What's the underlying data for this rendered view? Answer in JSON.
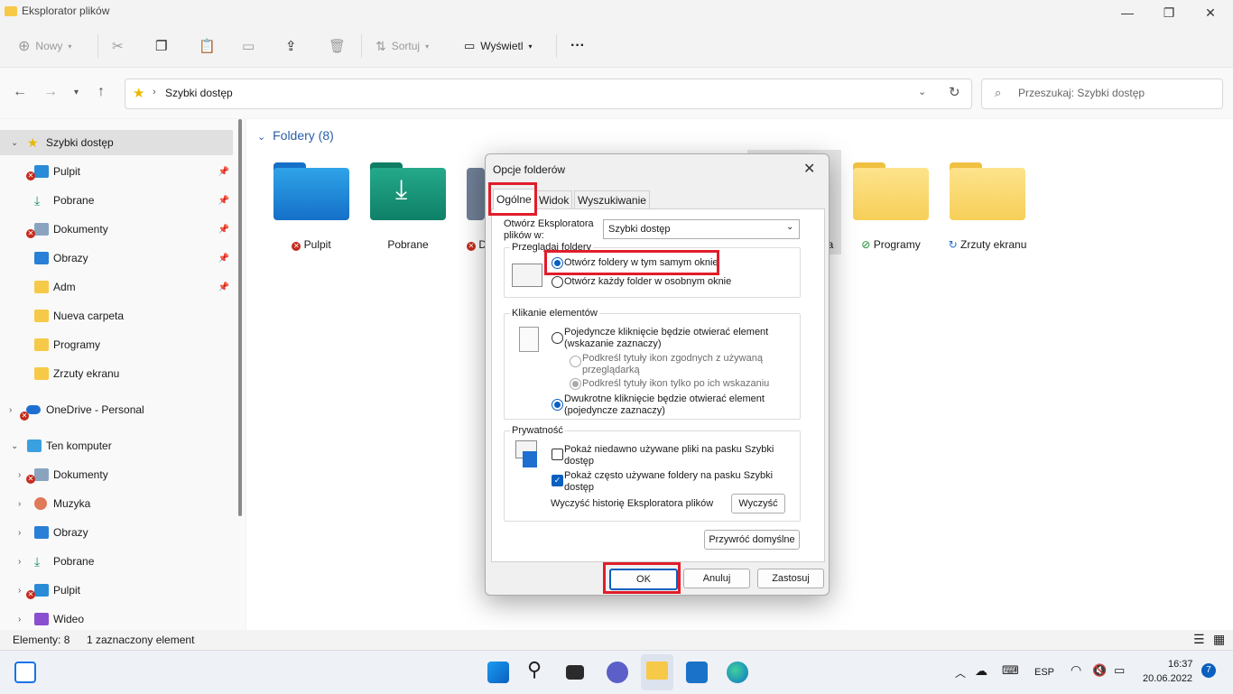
{
  "window": {
    "title": "Eksplorator plików"
  },
  "toolbar": {
    "new_label": "Nowy",
    "sort_label": "Sortuj",
    "view_label": "Wyświetl",
    "more_label": "···"
  },
  "address": {
    "path": "Szybki dostęp",
    "search_placeholder": "Przeszukaj: Szybki dostęp"
  },
  "sidebar": {
    "quick_access": "Szybki dostęp",
    "items": [
      "Pulpit",
      "Pobrane",
      "Dokumenty",
      "Obrazy",
      "Adm",
      "Nueva carpeta",
      "Programy",
      "Zrzuty ekranu"
    ],
    "onedrive": "OneDrive - Personal",
    "this_pc": "Ten komputer",
    "pc_items": [
      "Dokumenty",
      "Muzyka",
      "Obrazy",
      "Pobrane",
      "Pulpit",
      "Wideo"
    ]
  },
  "main": {
    "section_title": "Foldery (8)",
    "folders": [
      "Pulpit",
      "Pobrane",
      "D",
      "a",
      "Programy",
      "Zrzuty ekranu"
    ]
  },
  "status": {
    "count": "Elementy: 8",
    "selected": "1 zaznaczony element"
  },
  "taskbar": {
    "lang": "ESP",
    "time": "16:37",
    "date": "20.06.2022",
    "badge": "7"
  },
  "dialog": {
    "title": "Opcje folderów",
    "tabs": [
      "Ogólne",
      "Widok",
      "Wyszukiwanie"
    ],
    "open_label": "Otwórz Eksploratora plików w:",
    "open_value": "Szybki dostęp",
    "browse_group": "Przeglądaj foldery",
    "browse_same": "Otwórz foldery w tym samym oknie",
    "browse_new": "Otwórz każdy folder w osobnym oknie",
    "click_group": "Klikanie elementów",
    "click_single": "Pojedyncze kliknięcie będzie otwierać element (wskazanie zaznaczy)",
    "underline_browser": "Podkreśl tytuły ikon zgodnych z używaną przeglądarką",
    "underline_hover": "Podkreśl tytuły ikon tylko po ich wskazaniu",
    "click_double": "Dwukrotne kliknięcie będzie otwierać element (pojedyncze zaznaczy)",
    "privacy_group": "Prywatność",
    "recent_files": "Pokaż niedawno używane pliki na pasku Szybki dostęp",
    "frequent_folders": "Pokaż często używane foldery na pasku Szybki dostęp",
    "clear_history": "Wyczyść historię Eksploratora plików",
    "clear_button": "Wyczyść",
    "restore_button": "Przywróć domyślne",
    "ok": "OK",
    "cancel": "Anuluj",
    "apply": "Zastosuj"
  },
  "colors": {
    "accent": "#0a5fbf",
    "highlight": "#e11d2a",
    "folder_yellow": "#f7cf58"
  }
}
